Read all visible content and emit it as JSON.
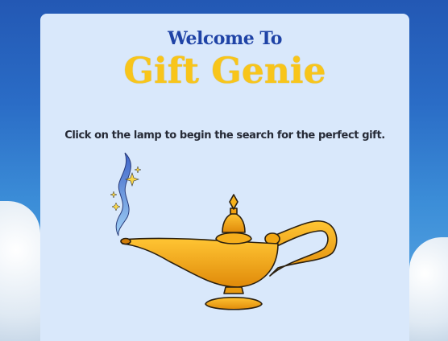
{
  "header": {
    "welcome": "Welcome To",
    "brand": "Gift Genie"
  },
  "main": {
    "instruction": "Click on the lamp to begin the search for the perfect gift.",
    "lamp_icon": "magic-lamp-icon"
  },
  "colors": {
    "brand": "#f8c51a",
    "welcome": "#1f43a6",
    "card": "#d9e8fb",
    "lamp": "#f3a712",
    "smoke": "#5b8de0"
  }
}
